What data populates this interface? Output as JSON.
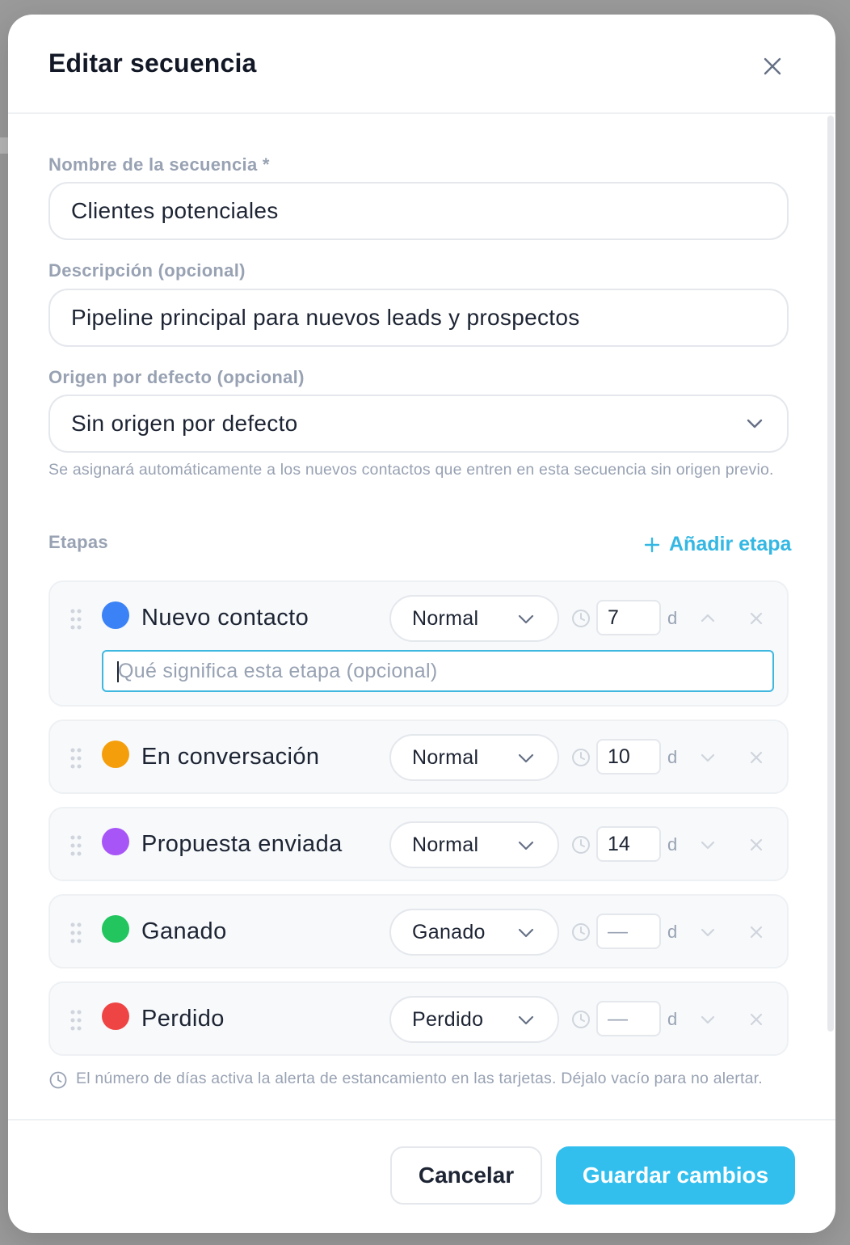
{
  "modal": {
    "title": "Editar secuencia"
  },
  "form": {
    "name_label": "Nombre de la secuencia *",
    "name_value": "Clientes potenciales",
    "description_label": "Descripción (opcional)",
    "description_value": "Pipeline principal para nuevos leads y prospectos",
    "origin_label": "Origen por defecto (opcional)",
    "origin_value": "Sin origen por defecto",
    "origin_hint": "Se asignará automáticamente a los nuevos contactos que entren en esta secuencia sin origen previo."
  },
  "stages": {
    "label": "Etapas",
    "add_label": "Añadir etapa",
    "days_unit": "d",
    "description_placeholder": "Qué significa esta etapa (opcional)",
    "items": [
      {
        "name": "Nuevo contacto",
        "color": "#3b82f6",
        "type": "Normal",
        "days": "7"
      },
      {
        "name": "En conversación",
        "color": "#f59e0b",
        "type": "Normal",
        "days": "10"
      },
      {
        "name": "Propuesta enviada",
        "color": "#a855f7",
        "type": "Normal",
        "days": "14"
      },
      {
        "name": "Ganado",
        "color": "#22c55e",
        "type": "Ganado",
        "days": "—"
      },
      {
        "name": "Perdido",
        "color": "#ef4444",
        "type": "Perdido",
        "days": "—"
      }
    ],
    "footer_note": "El número de días activa la alerta de estancamiento en las tarjetas. Déjalo vacío para no alertar."
  },
  "actions": {
    "cancel_label": "Cancelar",
    "save_label": "Guardar cambios"
  },
  "colors": {
    "accent": "#32bfee",
    "focus_border": "#3fb8e0"
  }
}
